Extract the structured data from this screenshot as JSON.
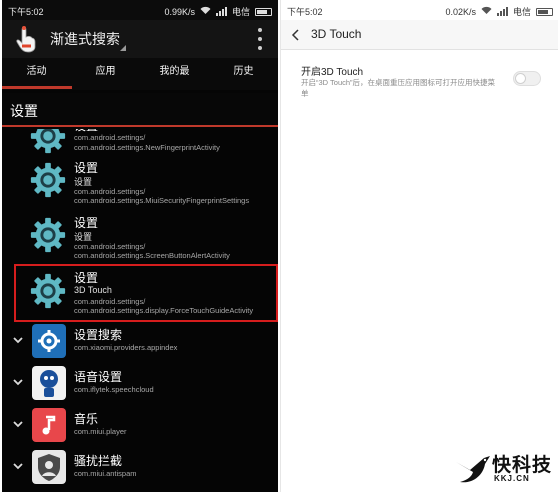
{
  "left": {
    "status": {
      "time": "下午5:02",
      "speed": "0.99K/s",
      "carrier": "电信"
    },
    "appbar": {
      "title": "渐進式搜索"
    },
    "tabs": [
      "活动",
      "应用",
      "我的最",
      "历史"
    ],
    "section": "设置",
    "partial_item": {
      "title": "设置",
      "pkg": "com.android.settings/",
      "activity": "com.android.settings.NewFingerprintActivity"
    },
    "items": [
      {
        "title": "设置",
        "sub": "设置",
        "pkg": "com.android.settings/",
        "activity": "com.android.settings.MiuiSecurityFingerprintSettings"
      },
      {
        "title": "设置",
        "sub": "设置",
        "pkg": "com.android.settings/",
        "activity": "com.android.settings.ScreenButtonAlertActivity"
      },
      {
        "title": "设置",
        "sub": "3D Touch",
        "pkg": "com.android.settings/",
        "activity": "com.android.settings.display.ForceTouchGuideActivity"
      }
    ],
    "apps": [
      {
        "title": "设置搜索",
        "pkg": "com.xiaomi.providers.appindex",
        "icon": "settings-search-icon",
        "color": "#1f6fb8"
      },
      {
        "title": "语音设置",
        "pkg": "com.iflytek.speechcloud",
        "icon": "voice-settings-icon",
        "color": "#1a4f9a"
      },
      {
        "title": "音乐",
        "pkg": "com.miui.player",
        "icon": "music-icon",
        "color": "#e8474b"
      },
      {
        "title": "骚扰拦截",
        "pkg": "com.miui.antispam",
        "icon": "antispam-shield-icon",
        "color": "#4a4a4a"
      }
    ]
  },
  "right": {
    "status": {
      "time": "下午5:02",
      "speed": "0.02K/s",
      "carrier": "电信"
    },
    "title": "3D Touch",
    "option": {
      "title": "开启3D Touch",
      "desc": "开启“3D Touch”后，在桌面重压应用图标可打开应用快捷菜单",
      "enabled": false
    }
  },
  "watermark": {
    "main": "快科技",
    "sub": "KKJ.CN"
  },
  "colors": {
    "accent_red": "#d61d1d",
    "tab_indicator": "#c0392b",
    "gear_teal": "#5fb8c4"
  }
}
